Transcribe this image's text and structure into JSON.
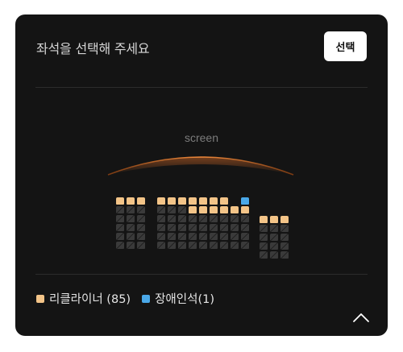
{
  "header": {
    "title": "좌석을 선택해 주세요",
    "select_button": "선택"
  },
  "screen": {
    "label": "screen"
  },
  "seat_map": {
    "blocks": [
      {
        "name": "left",
        "cols": 3,
        "rows": [
          [
            "r",
            "r",
            "r"
          ],
          [
            "x",
            "x",
            "x"
          ],
          [
            "x",
            "x",
            "x"
          ],
          [
            "x",
            "x",
            "x"
          ],
          [
            "x",
            "x",
            "x"
          ],
          [
            "x",
            "x",
            "x"
          ]
        ]
      },
      {
        "name": "center",
        "cols": 9,
        "rows": [
          [
            "r",
            "r",
            "r",
            "r",
            "r",
            "r",
            "r",
            "-",
            "a"
          ],
          [
            "x",
            "x",
            "x",
            "r",
            "r",
            "r",
            "r",
            "r",
            "r"
          ],
          [
            "x",
            "x",
            "x",
            "x",
            "x",
            "x",
            "x",
            "x",
            "x"
          ],
          [
            "x",
            "x",
            "x",
            "x",
            "x",
            "x",
            "x",
            "x",
            "x"
          ],
          [
            "x",
            "x",
            "x",
            "x",
            "x",
            "x",
            "x",
            "x",
            "x"
          ],
          [
            "x",
            "x",
            "x",
            "x",
            "x",
            "x",
            "x",
            "x",
            "x"
          ]
        ]
      },
      {
        "name": "right",
        "cols": 3,
        "rows": [
          [
            "-",
            "-",
            "-"
          ],
          [
            "r",
            "r",
            "r"
          ],
          [
            "x",
            "x",
            "x"
          ],
          [
            "x",
            "x",
            "x"
          ],
          [
            "x",
            "x",
            "x"
          ],
          [
            "x",
            "x",
            "x"
          ]
        ]
      }
    ]
  },
  "legend": {
    "items": [
      {
        "label": "리클라이너 (85)",
        "color": "#f3c488"
      },
      {
        "label": "장애인석(1)",
        "color": "#4aa8e8"
      }
    ]
  },
  "colors": {
    "panel_bg": "#141414",
    "recliner": "#f3c488",
    "accessible": "#4aa8e8",
    "taken": "#3a3a3a",
    "screen_glow": "#e8742a"
  },
  "icons": {
    "collapse": "chevron-up-icon"
  }
}
